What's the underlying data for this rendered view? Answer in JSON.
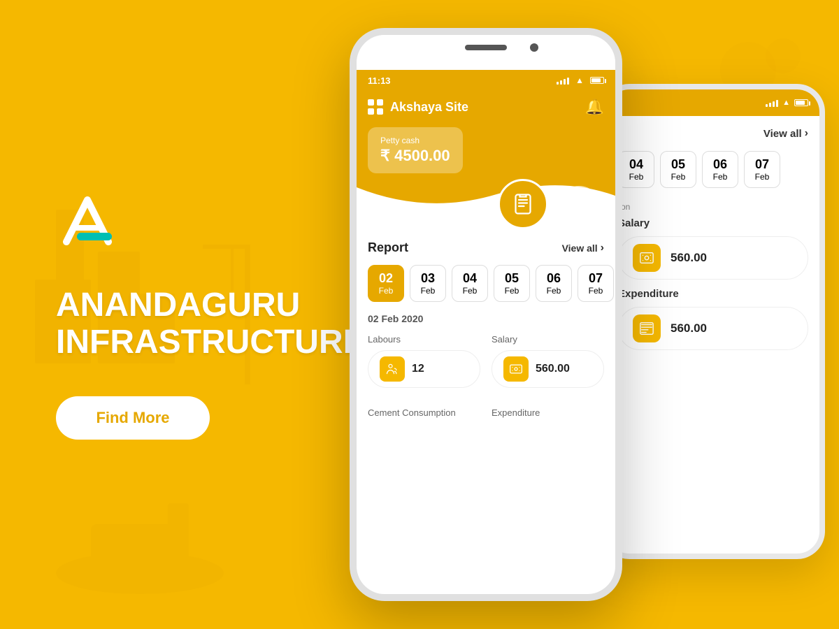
{
  "background": {
    "color": "#F5B800"
  },
  "brand": {
    "name": "ANANDAGURU\nINFRASTRUCTURE",
    "line1": "ANANDAGURU",
    "line2": "INFRASTRUCTURE"
  },
  "find_more_button": {
    "label": "Find More"
  },
  "phone_front": {
    "status_bar": {
      "time": "11:13"
    },
    "header": {
      "site_name": "Akshaya Site"
    },
    "petty_cash": {
      "label": "Petty cash",
      "amount": "₹ 4500.00"
    },
    "report_section": {
      "title": "Report",
      "view_all": "View all",
      "dates": [
        {
          "day": "02",
          "month": "Feb",
          "active": true
        },
        {
          "day": "03",
          "month": "Feb",
          "active": false
        },
        {
          "day": "04",
          "month": "Feb",
          "active": false
        },
        {
          "day": "05",
          "month": "Feb",
          "active": false
        },
        {
          "day": "06",
          "month": "Feb",
          "active": false
        },
        {
          "day": "07",
          "month": "Feb",
          "active": false
        }
      ],
      "selected_date": "02 Feb 2020",
      "labours_label": "Labours",
      "labours_count": "12",
      "salary_label": "Salary",
      "salary_amount": "560.00",
      "cement_label": "Cement Consumption",
      "expenditure_label": "Expenditure"
    }
  },
  "phone_back": {
    "view_all": "View all",
    "dates": [
      {
        "day": "04",
        "month": "Feb",
        "active": false
      },
      {
        "day": "05",
        "month": "Feb",
        "active": false
      },
      {
        "day": "06",
        "month": "Feb",
        "active": false
      },
      {
        "day": "07",
        "month": "Feb",
        "active": false
      }
    ],
    "salary_label": "Salary",
    "salary_amount": "560.00",
    "expenditure_label": "Expenditure",
    "expenditure_amount": "560.00"
  },
  "icons": {
    "grid": "⊞",
    "bell": "🔔",
    "chevron_right": "›",
    "labour": "👤",
    "salary": "💰",
    "clipboard": "📋",
    "worker": "👷"
  }
}
